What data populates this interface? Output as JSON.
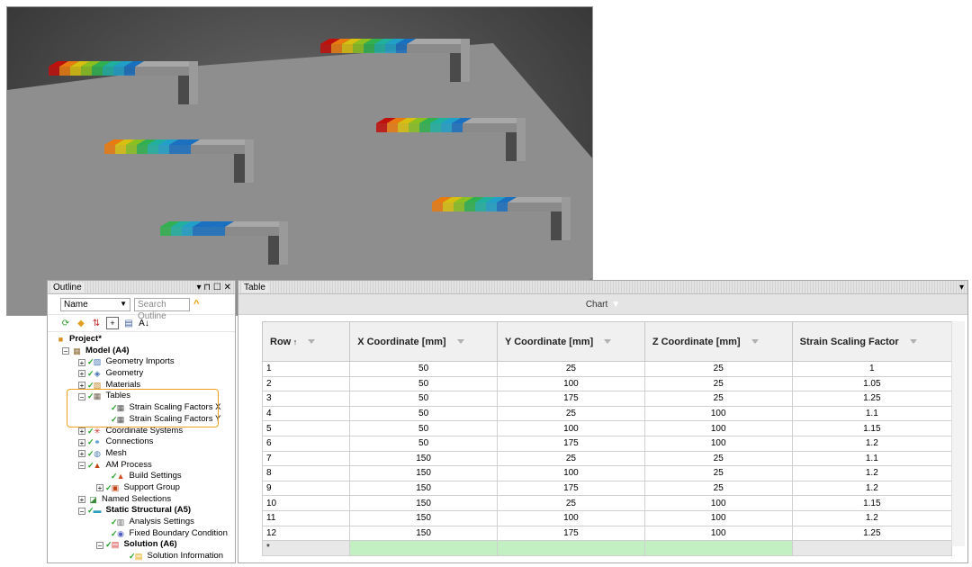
{
  "outline": {
    "title": "Outline",
    "ctrl_pin": "▾ ⊓ ☐ ✕",
    "name_select": "Name",
    "search_placeholder": "Search Outline",
    "tree": [
      {
        "label": "Project*",
        "bold": true
      },
      {
        "label": "Model (A4)",
        "bold": true
      },
      {
        "label": "Geometry Imports"
      },
      {
        "label": "Geometry"
      },
      {
        "label": "Materials"
      },
      {
        "label": "Tables"
      },
      {
        "label": "Strain Scaling Factors X"
      },
      {
        "label": "Strain Scaling Factors Y"
      },
      {
        "label": "Coordinate Systems"
      },
      {
        "label": "Connections"
      },
      {
        "label": "Mesh"
      },
      {
        "label": "AM Process"
      },
      {
        "label": "Build Settings"
      },
      {
        "label": "Support Group"
      },
      {
        "label": "Named Selections"
      },
      {
        "label": "Static Structural (A5)",
        "bold": true
      },
      {
        "label": "Analysis Settings"
      },
      {
        "label": "Fixed Boundary Condition"
      },
      {
        "label": "Solution (A6)",
        "bold": true
      },
      {
        "label": "Solution Information"
      }
    ]
  },
  "table": {
    "title": "Table",
    "chart_label": "Chart",
    "columns": [
      "Row",
      "X Coordinate [mm]",
      "Y Coordinate [mm]",
      "Z Coordinate [mm]",
      "Strain Scaling Factor"
    ],
    "rows": [
      [
        "1",
        "50",
        "25",
        "25",
        "1"
      ],
      [
        "2",
        "50",
        "100",
        "25",
        "1.05"
      ],
      [
        "3",
        "50",
        "175",
        "25",
        "1.25"
      ],
      [
        "4",
        "50",
        "25",
        "100",
        "1.1"
      ],
      [
        "5",
        "50",
        "100",
        "100",
        "1.15"
      ],
      [
        "6",
        "50",
        "175",
        "100",
        "1.2"
      ],
      [
        "7",
        "150",
        "25",
        "25",
        "1.1"
      ],
      [
        "8",
        "150",
        "100",
        "25",
        "1.2"
      ],
      [
        "9",
        "150",
        "175",
        "25",
        "1.2"
      ],
      [
        "10",
        "150",
        "25",
        "100",
        "1.15"
      ],
      [
        "11",
        "150",
        "100",
        "100",
        "1.2"
      ],
      [
        "12",
        "150",
        "175",
        "100",
        "1.25"
      ]
    ],
    "new_row_marker": "*"
  },
  "colors": {
    "highlight": "#f0a020",
    "new_row": "#c2f0c2",
    "contour": [
      "#c0100c",
      "#e87a10",
      "#d8c010",
      "#8ac020",
      "#30b050",
      "#20b0a0",
      "#20a0c8",
      "#1a70c0"
    ]
  }
}
